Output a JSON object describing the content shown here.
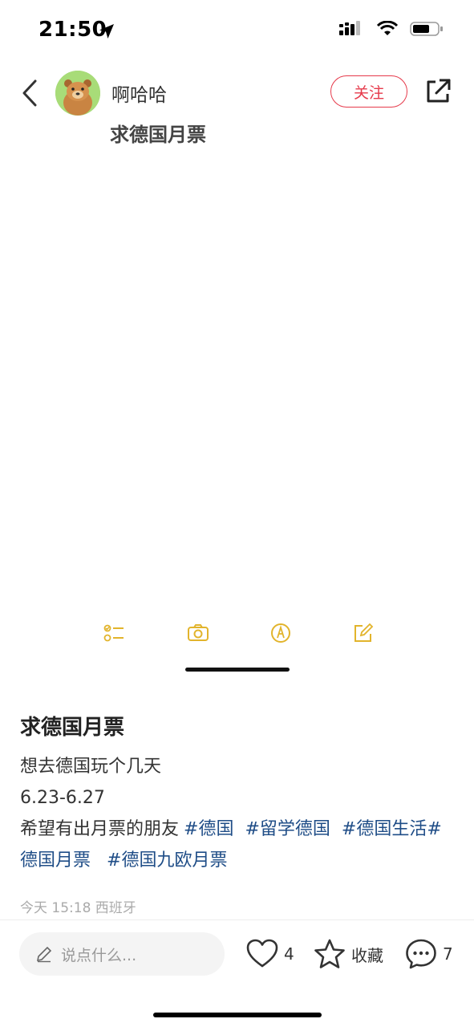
{
  "status_bar": {
    "time": "21:50",
    "icons": [
      "location-arrow-icon",
      "signal-icon",
      "wifi-icon",
      "battery-icon"
    ]
  },
  "header": {
    "author_name": "啊哈哈",
    "follow_label": "关注",
    "icons": [
      "back-chevron-icon",
      "share-icon"
    ]
  },
  "image": {
    "title_fragment": "求德国月票",
    "toolbar_icons": [
      "checklist-icon",
      "camera-icon",
      "markup-pen-icon",
      "compose-icon"
    ]
  },
  "post": {
    "title": "求德国月票",
    "lines": [
      "想去德国玩个几天",
      "6.23-6.27",
      "希望有出月票的朋友"
    ],
    "tags": [
      "#德国",
      "#留学德国",
      "#德国生活",
      "#德国月票",
      "#德国九欧月票"
    ],
    "meta": "今天 15:18 西班牙"
  },
  "bottom_bar": {
    "comment_placeholder": "说点什么...",
    "like_count": "4",
    "collect_label": "收藏",
    "comment_count": "7"
  },
  "colors": {
    "accent_red": "#e63a4b",
    "tag_blue": "#1f4d87",
    "toolbar_yellow": "#e2b42c"
  }
}
